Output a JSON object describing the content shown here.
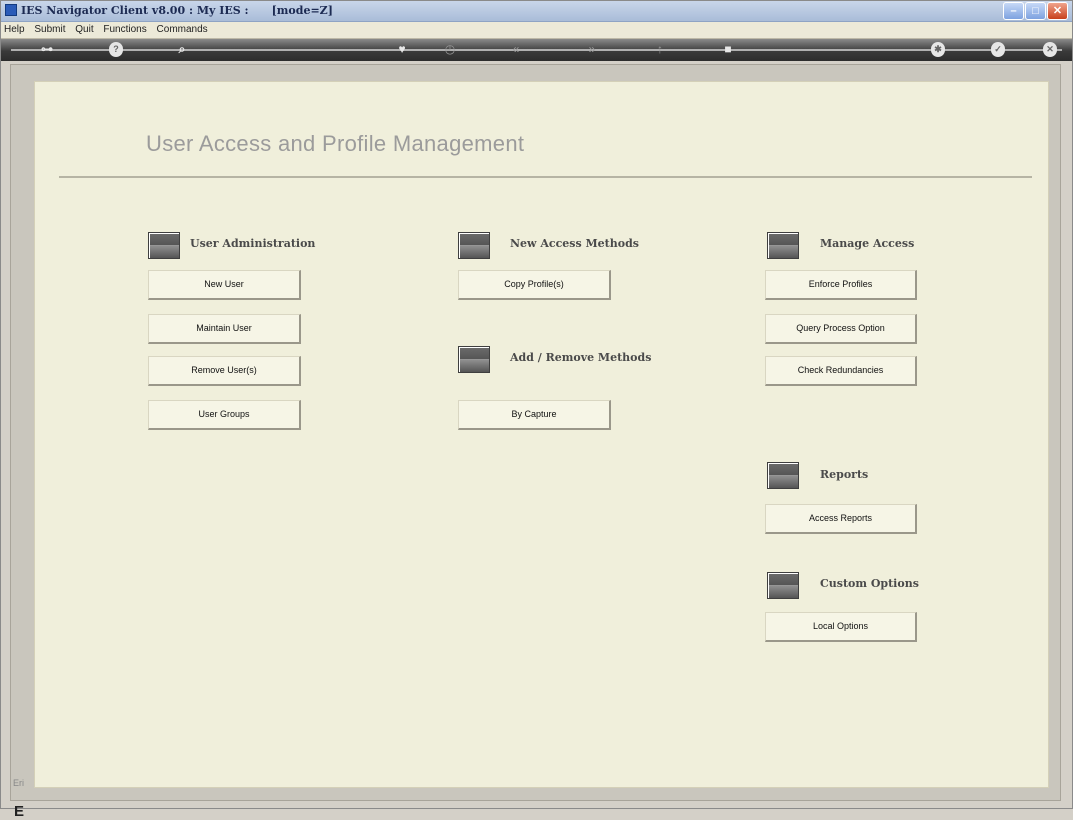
{
  "window": {
    "title": "IES Navigator Client v8.00 : My IES :      [mode=Z]"
  },
  "menu": [
    "Help",
    "Submit",
    "Quit",
    "Functions",
    "Commands"
  ],
  "toolbar": {
    "icons": [
      "key-icon",
      "help-icon",
      "search-icon",
      "heart-icon",
      "clock-icon",
      "rewind-icon",
      "forward-icon",
      "up-icon",
      "stop-icon",
      "settings-icon",
      "check-icon",
      "close-icon"
    ]
  },
  "page": {
    "title": "User Access and Profile Management"
  },
  "sections": {
    "user_admin": {
      "label": "User Administration",
      "buttons": [
        "New User",
        "Maintain User",
        "Remove User(s)",
        "User Groups"
      ]
    },
    "new_access": {
      "label": "New Access Methods",
      "buttons": [
        "Copy Profile(s)"
      ]
    },
    "add_remove": {
      "label": "Add / Remove Methods",
      "buttons": [
        "By Capture"
      ]
    },
    "manage_access": {
      "label": "Manage Access",
      "buttons": [
        "Enforce Profiles",
        "Query Process Option",
        "Check Redundancies"
      ]
    },
    "reports": {
      "label": "Reports",
      "buttons": [
        "Access Reports"
      ]
    },
    "custom": {
      "label": "Custom Options",
      "buttons": [
        "Local Options"
      ]
    }
  },
  "sidebar": {
    "label": "Eri",
    "char": "E"
  },
  "colors": {
    "panel": "#f0efdb",
    "toolbar": "#3a3a3a",
    "title": "#9b9b9b"
  }
}
